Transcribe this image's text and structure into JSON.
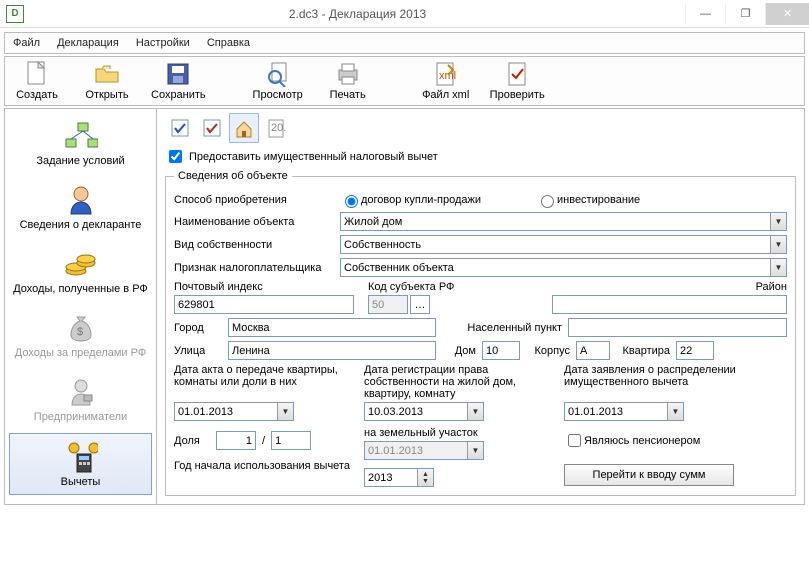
{
  "window": {
    "title": "2.dc3 - Декларация 2013",
    "app_icon_letter": "D"
  },
  "menu": {
    "file": "Файл",
    "decl": "Декларация",
    "settings": "Настройки",
    "help": "Справка"
  },
  "toolbar": {
    "new": "Создать",
    "open": "Открыть",
    "save": "Сохранить",
    "preview": "Просмотр",
    "print": "Печать",
    "xml": "Файл xml",
    "check": "Проверить"
  },
  "sidebar": {
    "items": [
      {
        "label": "Задание условий"
      },
      {
        "label": "Сведения о декларанте"
      },
      {
        "label": "Доходы, полученные в РФ"
      },
      {
        "label": "Доходы за пределами РФ"
      },
      {
        "label": "Предприниматели"
      },
      {
        "label": "Вычеты"
      }
    ]
  },
  "main": {
    "tabicon20": "20..",
    "checkbox_label": "Предоставить имущественный налоговый вычет",
    "fieldset_legend": "Сведения об объекте",
    "acq_label": "Способ приобретения",
    "acq_radio1": "договор купли-продажи",
    "acq_radio2": "инвестирование",
    "obj_label": "Наименование объекта",
    "obj_value": "Жилой дом",
    "own_label": "Вид собственности",
    "own_value": "Собственность",
    "taxp_label": "Признак налогоплательщика",
    "taxp_value": "Собственник объекта",
    "post_label": "Почтовый индекс",
    "post_value": "629801",
    "region_label": "Код субъекта РФ",
    "region_value": "50",
    "district_label": "Район",
    "district_value": "",
    "city_label": "Город",
    "city_value": "Москва",
    "town_label": "Населенный пункт",
    "town_value": "",
    "street_label": "Улица",
    "street_value": "Ленина",
    "house_label": "Дом",
    "house_value": "10",
    "korpus_label": "Корпус",
    "korpus_value": "А",
    "flat_label": "Квартира",
    "flat_value": "22",
    "date_act_label": "Дата акта о передаче квартиры, комнаты или доли в них",
    "date_reg_label": "Дата регистрации права собственности на жилой дом, квартиру, комнату",
    "date_claim_label": "Дата заявления о распределении имущественного вычета",
    "date_act_value": "01.01.2013",
    "date_reg_value": "10.03.2013",
    "date_claim_value": "01.01.2013",
    "land_label": "на земельный участок",
    "land_value": "01.01.2013",
    "share_label": "Доля",
    "share_num": "1",
    "share_den": "1",
    "share_sep": "/",
    "pensioner_label": "Являюсь пенсионером",
    "year_label": "Год начала использования вычета",
    "year_value": "2013",
    "goto_sums": "Перейти к вводу сумм"
  }
}
